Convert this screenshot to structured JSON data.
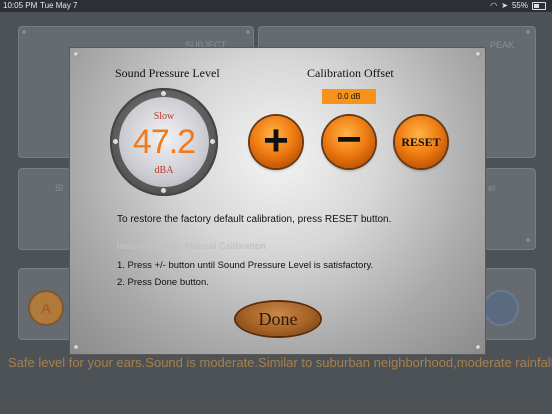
{
  "status_bar": {
    "time": "10:05 PM",
    "date": "Tue May 7",
    "battery": "55%"
  },
  "background": {
    "panel_label_1": "SUBJECT",
    "panel_label_2": "PEAK",
    "panel_label_3": "Sl",
    "panel_label_4": "el",
    "badge_letter": "A",
    "ticker": "Safe level for your ears.Sound is moderate.Similar to suburban neighborhood,moderate rainfall"
  },
  "modal": {
    "spl_label": "Sound Pressure Level",
    "cal_label": "Calibration Offset",
    "offset_value": "0.0 dB",
    "gauge": {
      "mode": "Slow",
      "value": "47.2",
      "unit": "dBA"
    },
    "buttons": {
      "plus": "+",
      "minus": "−",
      "reset": "RESET",
      "done": "Done"
    },
    "info": "To restore the factory default calibration, press RESET button.",
    "manual_title": "Instructions for Manual Calibration",
    "step1": "1. Press +/- button until Sound Pressure Level is satisfactory.",
    "step2": "2. Press Done button."
  },
  "colors": {
    "accent_orange": "#f37a1a",
    "gauge_red": "#c0392b",
    "offset_bg": "#f7931a"
  }
}
